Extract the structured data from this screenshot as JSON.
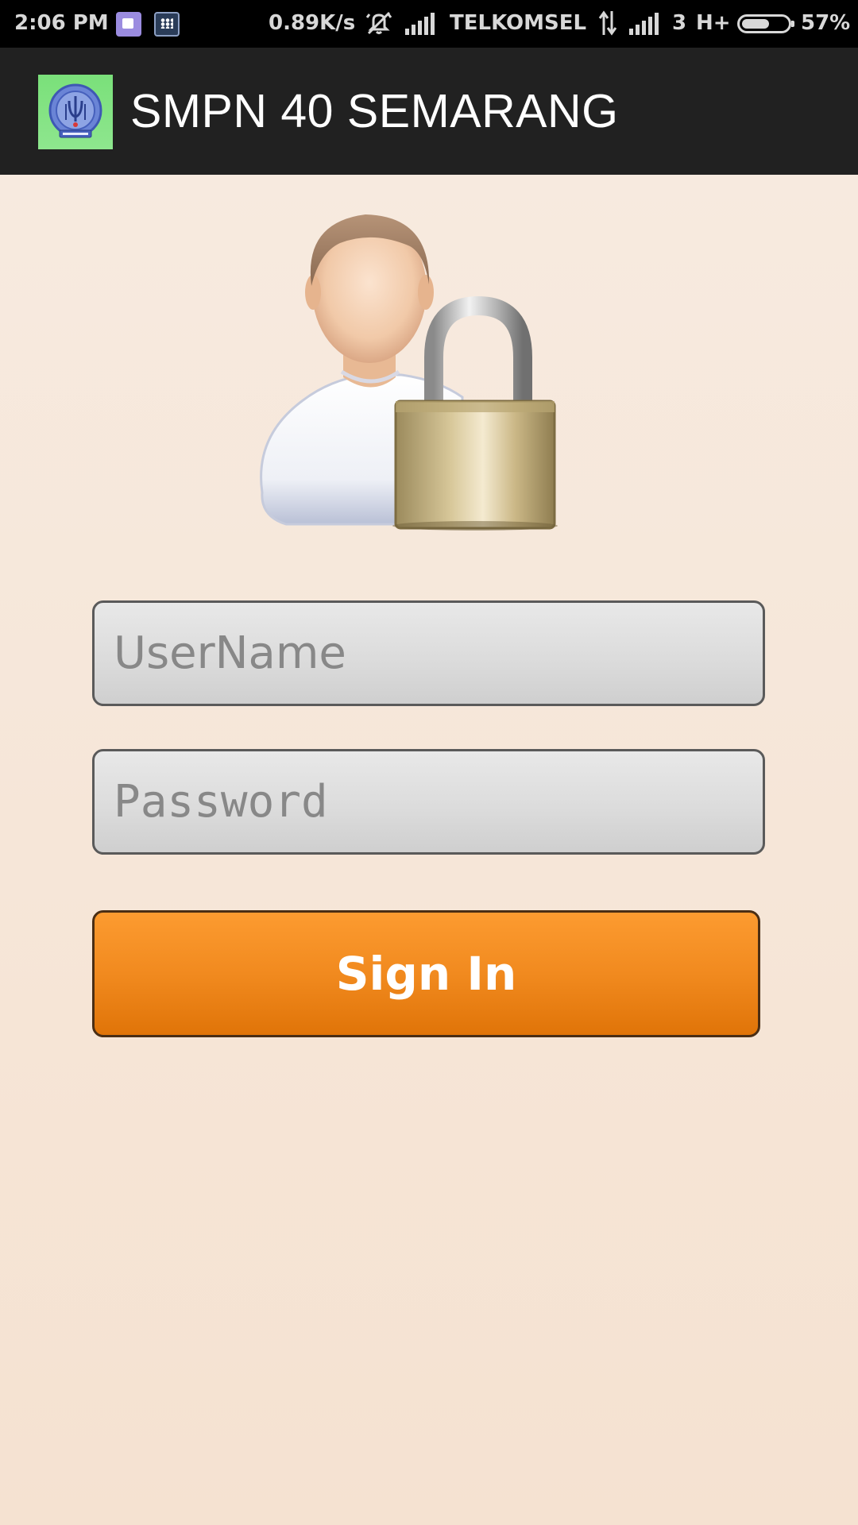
{
  "status_bar": {
    "time": "2:06 PM",
    "net_speed": "0.89K/s",
    "carrier": "TELKOMSEL",
    "sim_slot": "3",
    "network_type": "H+",
    "battery": "57%",
    "battery_level": 0.57,
    "icons": [
      "notification-app-icon",
      "bbm-icon",
      "mute-icon",
      "signal-icon",
      "data-arrows-icon",
      "signal-icon",
      "battery-icon"
    ]
  },
  "app_bar": {
    "title": "SMPN 40 SEMARANG",
    "logo_icon": "school-emblem-icon"
  },
  "login": {
    "illustration_icon": "user-lock-icon",
    "username_placeholder": "UserName",
    "username_value": "",
    "password_placeholder": "Password",
    "password_value": "",
    "signin_label": "Sign In"
  },
  "colors": {
    "background": "#f5e4d4",
    "action_bar": "#212121",
    "status_bar": "#000000",
    "signin_button": "#f18a1f",
    "field": "#dcdcdc"
  }
}
